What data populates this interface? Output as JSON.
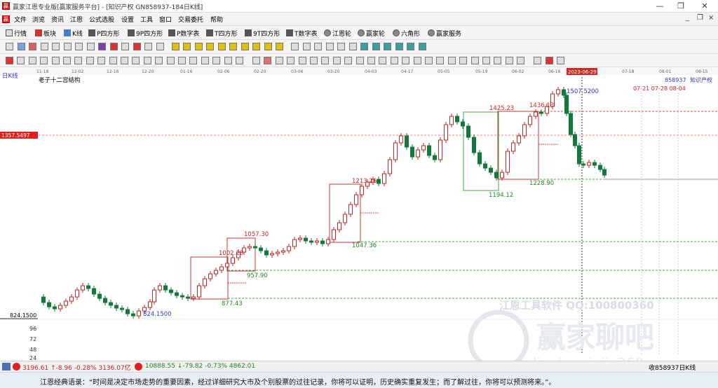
{
  "window": {
    "title": "赢家江恩专业版[赢家服务平台] - [知识产权  GN858937-184日K线]",
    "minimize": "—",
    "restore": "❐",
    "close": "✕",
    "mdi_min": "_",
    "mdi_restore": "❐",
    "mdi_close": "×"
  },
  "menu": [
    "文件",
    "浏览",
    "资讯",
    "江恩",
    "公式选股",
    "设置",
    "工具",
    "窗口",
    "交易委托",
    "帮助"
  ],
  "toolbar1": [
    {
      "label": "行情",
      "icon": "grid-icon"
    },
    {
      "label": "板块",
      "icon": "block-icon"
    },
    {
      "label": "K线",
      "icon": "kline-icon"
    },
    {
      "label": "P四方形",
      "icon": "p-square-icon"
    },
    {
      "label": "9P四方形",
      "icon": "9p-square-icon"
    },
    {
      "label": "P数字表",
      "icon": "p-table-icon"
    },
    {
      "label": "T四方形",
      "icon": "t-square-icon"
    },
    {
      "label": "9T四方形",
      "icon": "9t-square-icon"
    },
    {
      "label": "T数字表",
      "icon": "t-table-icon"
    },
    {
      "label": "江恩轮",
      "icon": "gann-wheel-icon"
    },
    {
      "label": "赢家轮",
      "icon": "winner-wheel-icon"
    },
    {
      "label": "六角形",
      "icon": "hexagon-icon"
    },
    {
      "label": "赢家服务",
      "icon": "service-icon"
    }
  ],
  "chart_header": {
    "period_label": "日K线",
    "structure_label": "老子十二宫结构",
    "code": "858937",
    "name": "知识产权",
    "current_date": "2023-06-29",
    "price_tag": "1357.5497",
    "axis_low": "824.1500",
    "future_dates": "07-21 07-28 08-04"
  },
  "date_ticks": [
    "11-18",
    "12-02",
    "12-16",
    "12-20",
    "01-16",
    "02-06",
    "02-20",
    "03-06",
    "03-20",
    "04-03",
    "04-17",
    "05-05",
    "05-19",
    "06-02",
    "06-16",
    "07-18",
    "08-01",
    "08-15"
  ],
  "volume_ticks": [
    "96",
    "72",
    "48",
    "24"
  ],
  "annotations": [
    {
      "text": "1507.5200",
      "color": "#3333cc"
    },
    {
      "text": "1436.13",
      "color": "#cc2222"
    },
    {
      "text": "1425.23",
      "color": "#cc2222"
    },
    {
      "text": "1228.90",
      "color": "#228822"
    },
    {
      "text": "1194.12",
      "color": "#228822"
    },
    {
      "text": "1213.26",
      "color": "#cc2222"
    },
    {
      "text": "1047.36",
      "color": "#228822"
    },
    {
      "text": "1057.30",
      "color": "#cc2222"
    },
    {
      "text": "1002.28",
      "color": "#cc2222"
    },
    {
      "text": "957.90",
      "color": "#228822"
    },
    {
      "text": "877.43",
      "color": "#228822"
    },
    {
      "text": "824.1500",
      "color": "#3333cc"
    }
  ],
  "watermark": {
    "line1": "江恩工具软件  QQ:100800360",
    "line2": "赢家聊吧",
    "line3": "liaoba.yinjia360.com"
  },
  "status": {
    "sh": "3196.61 ↑-8.96 -0.28% 3136.07亿",
    "sz": "10888.55 ↓-79.82 -0.73% 4862.01",
    "right": "收858937日K线"
  },
  "quote": "江恩经典语录：“时间是决定市场走势的重要因素，经过详细研究大市及个别股票的过往记录，你将可以证明，历史确实重复发生；而了解过往，你将可以预测将来。”。"
}
